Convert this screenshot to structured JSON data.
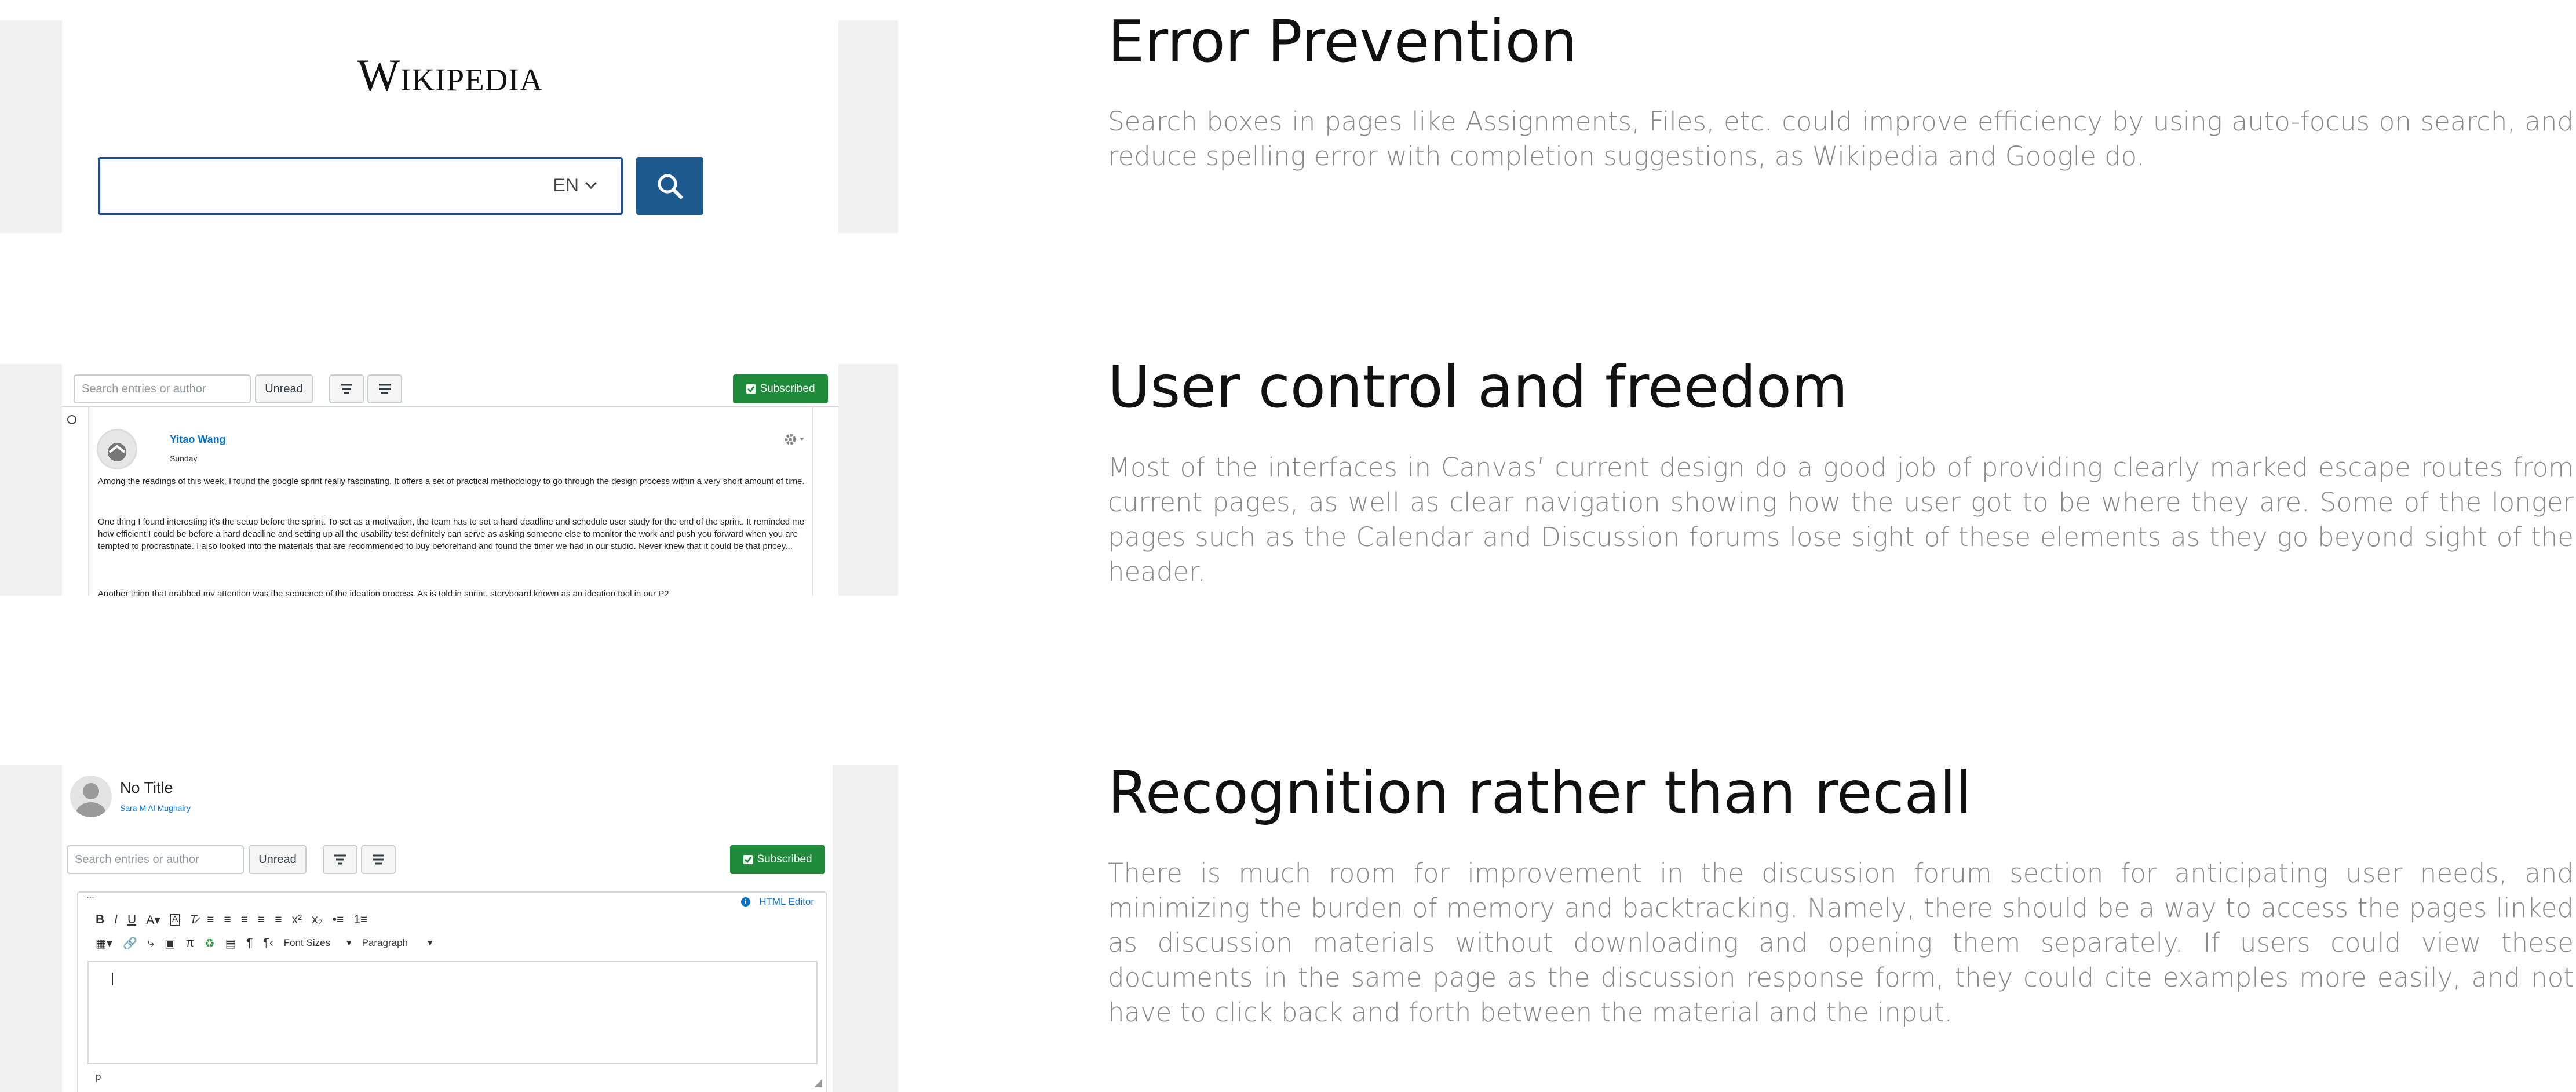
{
  "sections": [
    {
      "heading": "Error Prevention",
      "text": "Search boxes in pages like Assignments, Files, etc. could improve efficiency by using auto-focus on search, and reduce spelling error with completion suggestions, as Wikipedia and Google do."
    },
    {
      "heading": "User control and freedom",
      "text": "Most of the interfaces in Canvas’ current design do a good job of providing clearly marked escape routes from current pages, as well as clear navigation showing how the user got to be where they are. Some of the longer pages such as the Calendar and Discussion forums lose sight of these elements as they go beyond sight of the header."
    },
    {
      "heading": "Recognition rather than recall",
      "text": "There is much room for improvement in the discussion forum section for anticipating user needs, and minimizing the burden of memory and backtracking. Namely, there should be a way to access the pages linked as discussion materials without downloading and opening them separately. If users could view these documents in the same page as the discussion response form, they could cite examples more easily, and not have to click back and forth between the material and the input."
    }
  ],
  "wiki": {
    "logo": "Wikipedia",
    "lang": "EN"
  },
  "discussion": {
    "search_placeholder": "Search entries or author",
    "unread": "Unread",
    "subscribed": "Subscribed",
    "author": "Yitao Wang",
    "date": "Sunday",
    "p1": "Among the readings of this week, I found the google sprint really fascinating. It offers a set of practical methodology to go through the design process within a very short amount of time.",
    "p2": "One thing I found interesting it's the setup before the sprint. To set as a motivation, the team has to set a hard deadline and schedule user study for the end of the sprint. It reminded me how efficient I could be before a hard deadline and setting up all the usability test definitely can serve as asking someone else to monitor the work and push you forward when you are tempted to procrastinate. I also looked into the materials that are recommended to buy beforehand and found the timer we had in our studio. Never knew that it could be that pricey...",
    "p3": "Another thing that grabbed my attention was the sequence of the ideation process. As is told in sprint, storyboard known as an ideation tool in our P2"
  },
  "editor": {
    "title": "No Title",
    "author": "Sara M Al Mughairy",
    "search_placeholder": "Search entries or author",
    "unread": "Unread",
    "subscribed": "Subscribed",
    "html_editor": "HTML Editor",
    "font_sizes": "Font Sizes",
    "paragraph": "Paragraph",
    "path": "p"
  }
}
